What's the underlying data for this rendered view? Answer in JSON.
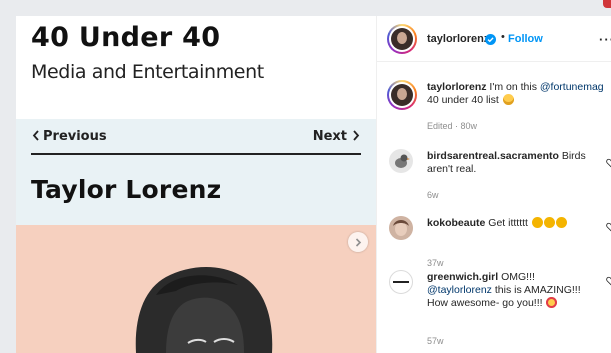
{
  "post_image": {
    "title": "40 Under 40",
    "subtitle": "Media and Entertainment",
    "nav_prev": "Previous",
    "nav_next": "Next",
    "person_name": "Taylor Lorenz"
  },
  "post_header": {
    "username": "taylorlorenz",
    "separator": "•",
    "follow_label": "Follow",
    "more_label": "···"
  },
  "caption": {
    "username": "taylorlorenz",
    "text_before": " I'm on this ",
    "mention": "@fortunemag",
    "text_after": " 40 under 40 list",
    "meta": "Edited · 80w"
  },
  "comments": [
    {
      "username": "birdsarentreal.sacramento",
      "text": " Birds aren't real.",
      "time": "6w"
    },
    {
      "username": "kokobeaute",
      "text": " Get itttttt",
      "time": "37w"
    },
    {
      "username": "greenwich.girl",
      "text_before": " OMG!!! ",
      "mention": "@taylorlorenz",
      "text_after": " this is AMAZING!!! How awesome- go you!!!",
      "time": "57w"
    }
  ],
  "colors": {
    "follow_blue": "#0095f6",
    "mention_blue": "#00376b",
    "verified_blue": "#0095f6",
    "photo_background": "#f6d0bf",
    "nav_band": "#e9f2f5"
  },
  "icons": [
    "verified-badge-icon",
    "more-options-icon",
    "heart-icon",
    "chevron-left-icon",
    "chevron-right-icon",
    "carousel-next-icon",
    "grinning-face-emoji",
    "clapping-hands-emoji",
    "heart-eyes-emoji"
  ]
}
